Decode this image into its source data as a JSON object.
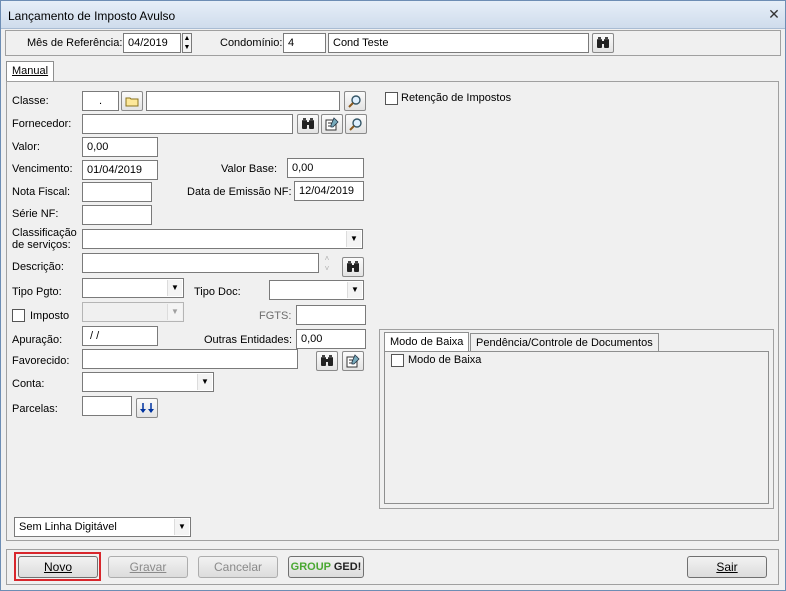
{
  "window": {
    "title": "Lançamento de Imposto Avulso"
  },
  "header": {
    "mes_label": "Mês de Referência:",
    "mes_value": "04/2019",
    "condominio_label": "Condomínio:",
    "condominio_code": "4",
    "condominio_name": "Cond Teste"
  },
  "tabs": {
    "manual": "Manual"
  },
  "form": {
    "classe_label": "Classe:",
    "classe_code": ".",
    "classe_desc": "",
    "fornecedor_label": "Fornecedor:",
    "fornecedor_value": "",
    "valor_label": "Valor:",
    "valor_value": "0,00",
    "vencimento_label": "Vencimento:",
    "vencimento_value": "01/04/2019",
    "valor_base_label": "Valor Base:",
    "valor_base_value": "0,00",
    "nota_fiscal_label": "Nota Fiscal:",
    "nota_fiscal_value": "",
    "data_emissao_label": "Data de Emissão NF:",
    "data_emissao_value": "12/04/2019",
    "serie_label": "Série NF:",
    "serie_value": "",
    "classificacao_label_1": "Classificação",
    "classificacao_label_2": "de serviços:",
    "classificacao_value": "",
    "descricao_label": "Descrição:",
    "descricao_value": "",
    "tipo_pgto_label": "Tipo Pgto:",
    "tipo_pgto_value": "",
    "tipo_doc_label": "Tipo Doc:",
    "tipo_doc_value": "",
    "imposto_label": "Imposto",
    "fgts_label": "FGTS:",
    "fgts_value": "",
    "apuracao_label": "Apuração:",
    "apuracao_value": " / /",
    "outras_entidades_label": "Outras Entidades:",
    "outras_entidades_value": "0,00",
    "favorecido_label": "Favorecido:",
    "favorecido_value": "",
    "conta_label": "Conta:",
    "conta_value": "",
    "parcelas_label": "Parcelas:",
    "parcelas_value": "",
    "linha_digitavel_value": "Sem Linha Digitável",
    "retencao_label": "Retenção de Impostos"
  },
  "panel": {
    "tab_modo_baixa": "Modo de Baixa",
    "tab_pendencia": "Pendência/Controle de Documentos",
    "modo_baixa_check": "Modo de Baixa"
  },
  "footer": {
    "novo": "Novo",
    "gravar": "Gravar",
    "cancelar": "Cancelar",
    "group_ged_1": "GROUP",
    "group_ged_2": "GED!",
    "sair": "Sair"
  },
  "colors": {
    "highlight": "#d8262c",
    "ged_green": "#4aa832"
  }
}
